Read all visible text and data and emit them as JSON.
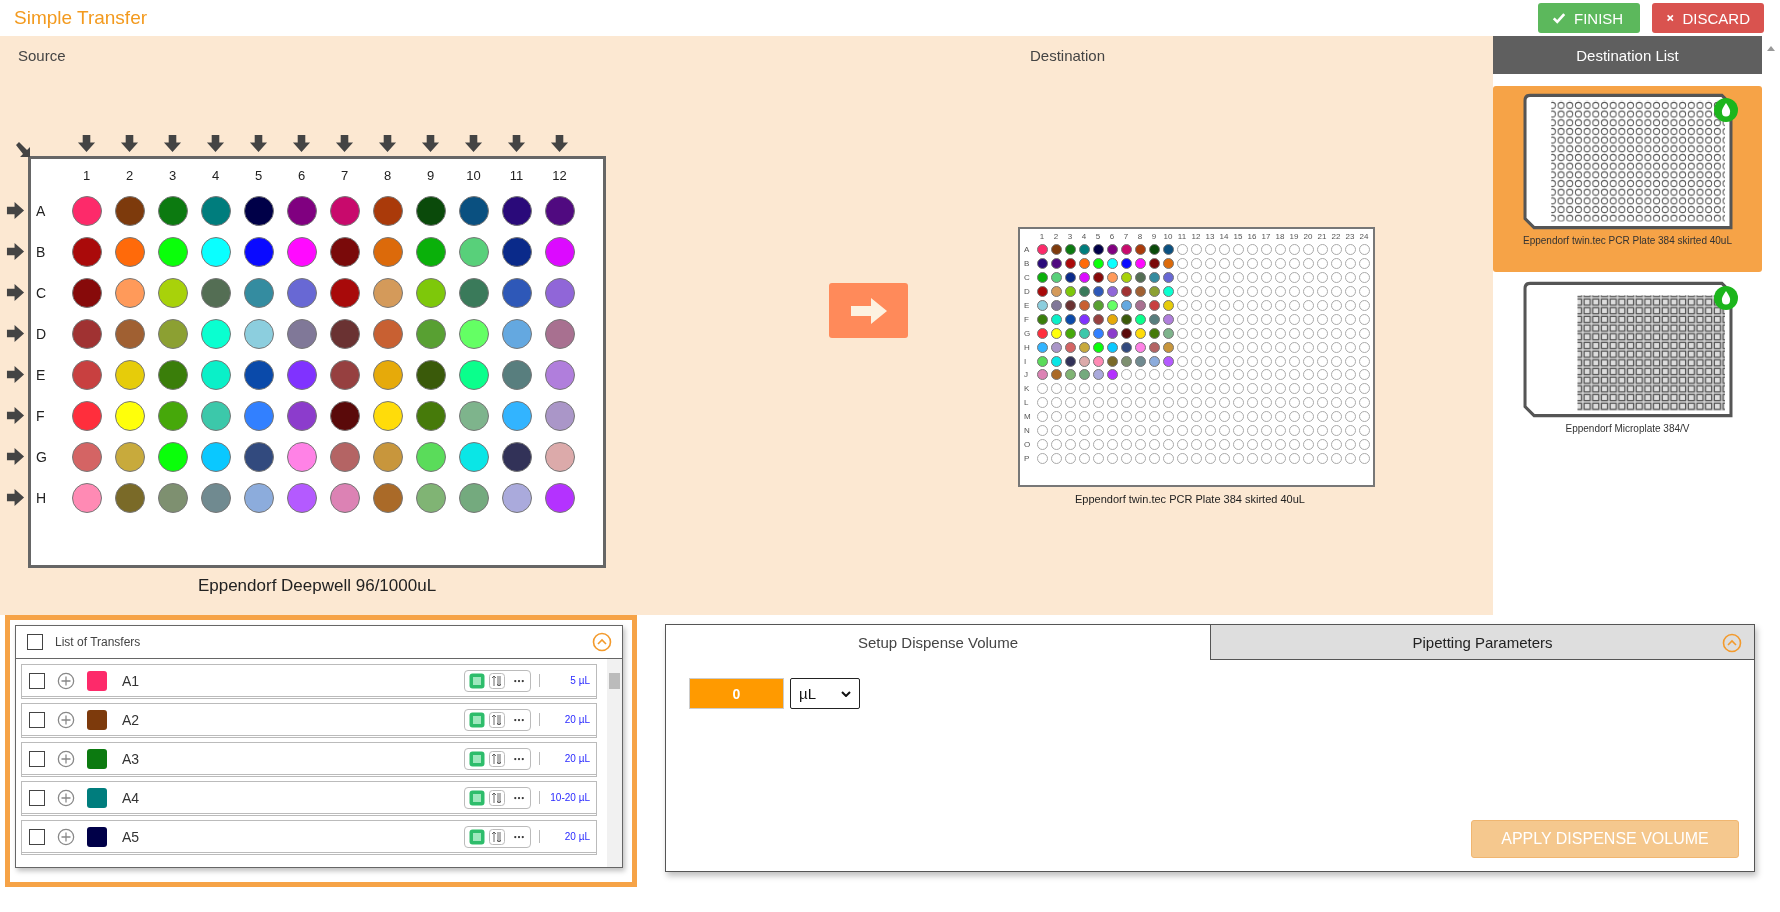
{
  "app_title": "Simple Transfer",
  "header_buttons": [
    {
      "kind": "finish",
      "label": "FINISH"
    },
    {
      "kind": "discard",
      "label": "DISCARD"
    }
  ],
  "source": {
    "title": "Source",
    "plate_name": "Eppendorf Deepwell 96/1000uL",
    "columns": [
      "1",
      "2",
      "3",
      "4",
      "5",
      "6",
      "7",
      "8",
      "9",
      "10",
      "11",
      "12"
    ],
    "rows": [
      {
        "label": "A",
        "wells": [
          {
            "color": "#fd2a6a"
          },
          {
            "color": "#7d3a0c"
          },
          {
            "color": "#0c7a10"
          },
          {
            "color": "#007d7d"
          },
          {
            "color": "#000048"
          },
          {
            "color": "#800080"
          },
          {
            "color": "#c80a6c"
          },
          {
            "color": "#aa3a0a"
          },
          {
            "color": "#0a4a0a"
          },
          {
            "color": "#0a5080"
          },
          {
            "color": "#2a0a7a"
          },
          {
            "color": "#500a80"
          }
        ]
      },
      {
        "label": "B",
        "wells": [
          {
            "color": "#aa0a0a"
          },
          {
            "color": "#ff6a0a"
          },
          {
            "color": "#0aff0a"
          },
          {
            "color": "#0affff"
          },
          {
            "color": "#0a0aff"
          },
          {
            "color": "#ff0aff"
          },
          {
            "color": "#7a0a0a"
          },
          {
            "color": "#dc6a0a"
          },
          {
            "color": "#0ab00a"
          },
          {
            "color": "#58d07a"
          },
          {
            "color": "#0a2a8a"
          },
          {
            "color": "#dc0aff"
          }
        ]
      },
      {
        "label": "C",
        "wells": [
          {
            "color": "#870a0a"
          },
          {
            "color": "#ff9a5a"
          },
          {
            "color": "#a8d20a"
          },
          {
            "color": "#546e54"
          },
          {
            "color": "#348ca0"
          },
          {
            "color": "#6868d4"
          },
          {
            "color": "#a80a0a"
          },
          {
            "color": "#d49a5a"
          },
          {
            "color": "#7ec80a"
          },
          {
            "color": "#3a7a5a"
          },
          {
            "color": "#2e58b8"
          },
          {
            "color": "#9066d8"
          }
        ]
      },
      {
        "label": "D",
        "wells": [
          {
            "color": "#a03232"
          },
          {
            "color": "#a06032"
          },
          {
            "color": "#8ca032"
          },
          {
            "color": "#0affd0"
          },
          {
            "color": "#8ccede"
          },
          {
            "color": "#807898"
          },
          {
            "color": "#6a3232"
          },
          {
            "color": "#c86032"
          },
          {
            "color": "#58a032"
          },
          {
            "color": "#64ff64"
          },
          {
            "color": "#64a8e0"
          },
          {
            "color": "#a87090"
          }
        ]
      },
      {
        "label": "E",
        "wells": [
          {
            "color": "#c84040"
          },
          {
            "color": "#e6cc0a"
          },
          {
            "color": "#3a7e0a"
          },
          {
            "color": "#0af0c8"
          },
          {
            "color": "#0a4aaa"
          },
          {
            "color": "#8032ff"
          },
          {
            "color": "#964040"
          },
          {
            "color": "#e6aa0a"
          },
          {
            "color": "#3a5a0a"
          },
          {
            "color": "#0aff8c"
          },
          {
            "color": "#587e7e"
          },
          {
            "color": "#b07edc"
          }
        ]
      },
      {
        "label": "F",
        "wells": [
          {
            "color": "#ff2e3c"
          },
          {
            "color": "#ffff0a"
          },
          {
            "color": "#46a80a"
          },
          {
            "color": "#3cc8aa"
          },
          {
            "color": "#3280ff"
          },
          {
            "color": "#8c3ccc"
          },
          {
            "color": "#5a0a0a"
          },
          {
            "color": "#ffdc0a"
          },
          {
            "color": "#467a0a"
          },
          {
            "color": "#7eb48c"
          },
          {
            "color": "#32b4ff"
          },
          {
            "color": "#aa96c8"
          }
        ]
      },
      {
        "label": "G",
        "wells": [
          {
            "color": "#d46464"
          },
          {
            "color": "#c8aa3c"
          },
          {
            "color": "#0aff0a"
          },
          {
            "color": "#0ac8ff"
          },
          {
            "color": "#324a7e"
          },
          {
            "color": "#ff82e6"
          },
          {
            "color": "#b46464"
          },
          {
            "color": "#c8963c"
          },
          {
            "color": "#5adc5a"
          },
          {
            "color": "#0ae6e6"
          },
          {
            "color": "#323258"
          },
          {
            "color": "#dcaaaa"
          }
        ]
      },
      {
        "label": "H",
        "wells": [
          {
            "color": "#ff8ab4"
          },
          {
            "color": "#7a6a28"
          },
          {
            "color": "#7e9070"
          },
          {
            "color": "#708a90"
          },
          {
            "color": "#8cacdc"
          },
          {
            "color": "#b45aff"
          },
          {
            "color": "#dc82b4"
          },
          {
            "color": "#aa6a28"
          },
          {
            "color": "#80b474"
          },
          {
            "color": "#74aa7e"
          },
          {
            "color": "#aaaadc"
          },
          {
            "color": "#b432ff"
          }
        ]
      }
    ]
  },
  "destination": {
    "title": "Destination",
    "plate_name": "Eppendorf twin.tec PCR Plate 384 skirted 40uL",
    "columns": [
      "1",
      "2",
      "3",
      "4",
      "5",
      "6",
      "7",
      "8",
      "9",
      "10",
      "11",
      "12",
      "13",
      "14",
      "15",
      "16",
      "17",
      "18",
      "19",
      "20",
      "21",
      "22",
      "23",
      "24"
    ],
    "rows": [
      "A",
      "B",
      "C",
      "D",
      "E",
      "F",
      "G",
      "H",
      "I",
      "J",
      "K",
      "L",
      "M",
      "N",
      "O",
      "P"
    ]
  },
  "destination_list": {
    "title": "Destination List",
    "items": [
      {
        "name": "Eppendorf twin.tec PCR Plate 384 skirted 40uL",
        "kind": "round",
        "selected": true
      },
      {
        "name": "Eppendorf Microplate 384/V",
        "kind": "square",
        "selected": false
      }
    ]
  },
  "transfers": {
    "title": "List of Transfers",
    "checked": false,
    "items": [
      {
        "well": "A1",
        "color": "#fd2a6a",
        "volume": "5 µL",
        "checked": false
      },
      {
        "well": "A2",
        "color": "#7d3a0c",
        "volume": "20 µL",
        "checked": false
      },
      {
        "well": "A3",
        "color": "#0c7a10",
        "volume": "20 µL",
        "checked": false
      },
      {
        "well": "A4",
        "color": "#007d7d",
        "volume": "10-20 µL",
        "checked": false
      },
      {
        "well": "A5",
        "color": "#000048",
        "volume": "20 µL",
        "checked": false
      }
    ]
  },
  "settings": {
    "tabs": [
      {
        "label": "Setup Dispense Volume",
        "selected": true
      },
      {
        "label": "Pipetting Parameters",
        "selected": false
      }
    ],
    "volume_value": "0",
    "unit": "µL",
    "apply_button": {
      "label": "APPLY DISPENSE VOLUME",
      "disabled": true
    }
  }
}
